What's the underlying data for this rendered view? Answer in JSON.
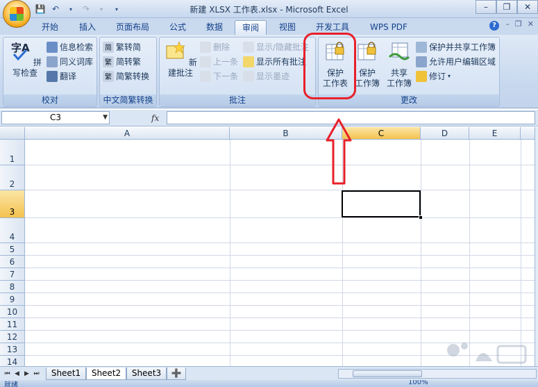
{
  "window": {
    "title": "新建 XLSX 工作表.xlsx - Microsoft Excel"
  },
  "tabs": [
    {
      "label": "开始"
    },
    {
      "label": "插入"
    },
    {
      "label": "页面布局"
    },
    {
      "label": "公式"
    },
    {
      "label": "数据"
    },
    {
      "label": "审阅",
      "active": true
    },
    {
      "label": "视图"
    },
    {
      "label": "开发工具"
    },
    {
      "label": "WPS PDF"
    }
  ],
  "ribbon": {
    "proofing": {
      "label": "校对",
      "spell_check": "拼写检查",
      "research": "信息检索",
      "thesaurus": "同义词库",
      "translate": "翻译"
    },
    "chinese_conversion": {
      "label": "中文简繁转换",
      "to_simplified": "繁转简",
      "to_traditional": "简转繁",
      "conversion": "简繁转换"
    },
    "comments": {
      "label": "批注",
      "new_comment": "新建批注",
      "delete": "删除",
      "previous": "上一条",
      "next": "下一条",
      "show_hide": "显示/隐藏批注",
      "show_all": "显示所有批注",
      "show_ink": "显示墨迹"
    },
    "changes": {
      "label": "更改",
      "protect_sheet_line1": "保护",
      "protect_sheet_line2": "工作表",
      "protect_workbook_line1": "保护",
      "protect_workbook_line2": "工作簿",
      "share_workbook_line1": "共享",
      "share_workbook_line2": "工作簿",
      "protect_and_share": "保护并共享工作簿",
      "allow_edit_ranges": "允许用户编辑区域",
      "track_changes": "修订"
    }
  },
  "formula_bar": {
    "name_box": "C3",
    "fx": "fx",
    "formula": ""
  },
  "grid": {
    "columns": [
      "A",
      "B",
      "C",
      "D",
      "E"
    ],
    "rows": [
      "1",
      "2",
      "3",
      "4",
      "5",
      "6",
      "7",
      "8",
      "9",
      "10",
      "11",
      "12",
      "13",
      "14"
    ],
    "active_cell": "C3"
  },
  "sheets": [
    {
      "label": "Sheet1"
    },
    {
      "label": "Sheet2",
      "active": true
    },
    {
      "label": "Sheet3"
    }
  ],
  "status": {
    "ready": "就绪",
    "zoom": "100%"
  },
  "colors": {
    "highlight": "#e8202a",
    "selected_header": "#f4c24f"
  }
}
